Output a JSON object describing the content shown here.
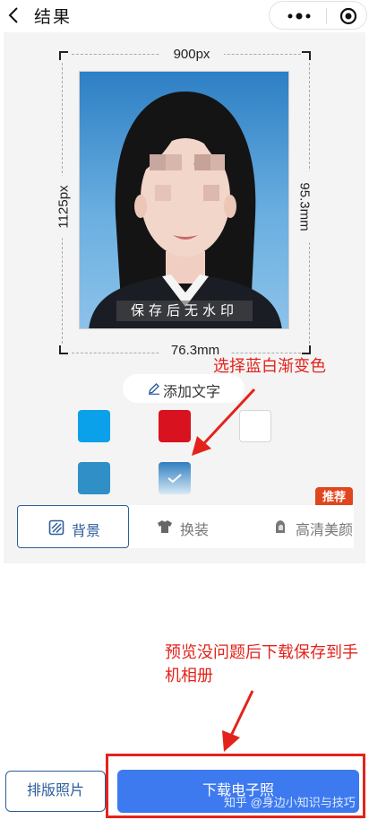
{
  "header": {
    "title": "结果",
    "icons": [
      "back-icon",
      "more-icon",
      "target-icon"
    ]
  },
  "photo": {
    "width_label": "900px",
    "height_label": "1125px",
    "physical_width": "76.3mm",
    "physical_height": "95.3mm",
    "watermark": "保存后无水印",
    "background": "blue-gradient"
  },
  "annotations": {
    "gradient_hint": "选择蓝白渐变色",
    "download_hint": "预览没问题后下载保存到手机相册"
  },
  "editor": {
    "add_text_label": "添加文字"
  },
  "colors": {
    "swatches": [
      "#0aa0ea",
      "#d8121e",
      "#ffffff",
      "#2f8fc6",
      "blue-white-gradient"
    ],
    "selected_index": 4,
    "accent": "#2c5e9c",
    "annotation": "#e3231b",
    "primary_button": "#3d7af0"
  },
  "tabs": {
    "items": [
      {
        "label": "背景",
        "icon": "background-icon",
        "active": true
      },
      {
        "label": "换装",
        "icon": "shirt-icon",
        "active": false
      },
      {
        "label": "高清美颜",
        "icon": "beauty-icon",
        "active": false
      }
    ],
    "badge": "推荐"
  },
  "footer": {
    "layout_label": "排版照片",
    "download_label": "下载电子照",
    "watermark": "知乎 @身边小知识与技巧"
  }
}
